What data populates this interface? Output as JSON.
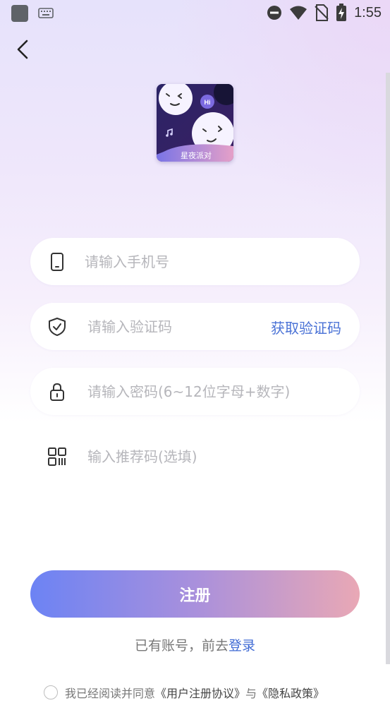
{
  "status_bar": {
    "time": "1:55"
  },
  "logo": {
    "text": "星夜派对",
    "hi": "Hi"
  },
  "fields": {
    "phone_placeholder": "请输入手机号",
    "code_placeholder": "请输入验证码",
    "get_code_label": "获取验证码",
    "password_placeholder": "请输入密码(6~12位字母+数字)",
    "referral_placeholder": "输入推荐码(选填)"
  },
  "register_label": "注册",
  "login": {
    "prefix": "已有账号，前去",
    "link": "登录"
  },
  "agreement": {
    "prefix": "我已经阅读并同意",
    "user_agreement": "《用户注册协议》",
    "conj": "与",
    "privacy": "《隐私政策》"
  },
  "colors": {
    "accent": "#4a72d6",
    "button_start": "#6c83f4",
    "button_end": "#e9a8b5",
    "logo_bg": "#2a1c5a"
  }
}
